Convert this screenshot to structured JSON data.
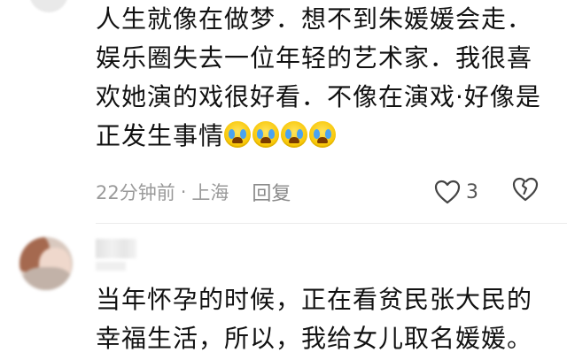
{
  "comments": [
    {
      "text": "人生就像在做梦．想不到朱媛媛会走．娱乐圈失去一位年轻的艺术家．我很喜欢她演的戏很好看．不像在演戏·好像是正发生事情",
      "emoji": [
        "crying-face-icon",
        "crying-face-icon",
        "crying-face-icon",
        "crying-face-icon"
      ],
      "time": "22分钟前",
      "separator": "·",
      "location": "上海",
      "reply_label": "回复",
      "likes": "3"
    },
    {
      "text": "当年怀孕的时候，正在看贫民张大民的幸福生活，所以，我给女儿取名媛媛。"
    }
  ],
  "colors": {
    "meta_gray": "#9a9a9a",
    "divider": "#ececec",
    "emoji_yellow": "#f7c400",
    "tear_blue": "#4aa3f0"
  }
}
